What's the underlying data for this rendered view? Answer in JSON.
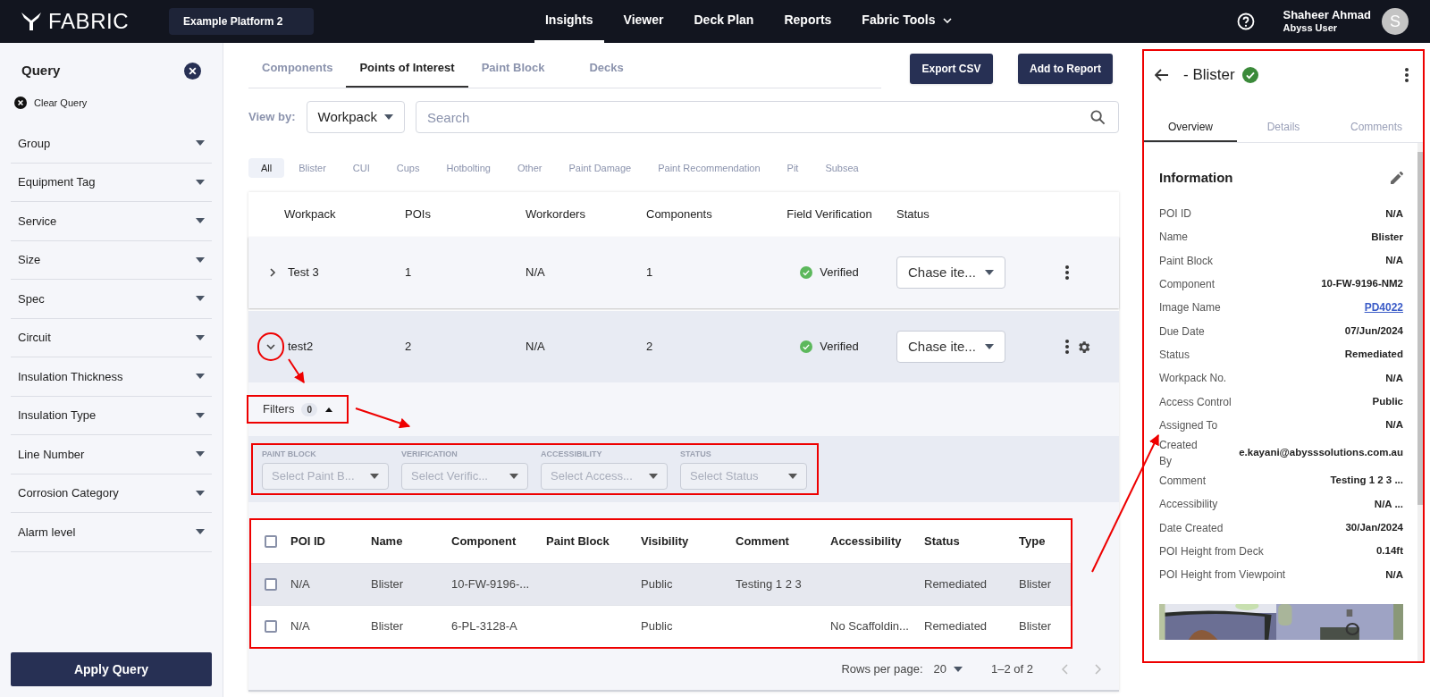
{
  "app": {
    "logo": "FABRIC",
    "platform": "Example Platform 2"
  },
  "nav": [
    {
      "label": "Insights",
      "selected": true,
      "has_menu": false
    },
    {
      "label": "Viewer",
      "selected": false,
      "has_menu": false
    },
    {
      "label": "Deck Plan",
      "selected": false,
      "has_menu": false
    },
    {
      "label": "Reports",
      "selected": false,
      "has_menu": false
    },
    {
      "label": "Fabric Tools",
      "selected": false,
      "has_menu": true
    }
  ],
  "user": {
    "name": "Shaheer Ahmad",
    "role": "Abyss User",
    "initial": "S"
  },
  "query": {
    "title": "Query",
    "clear": "Clear Query",
    "filters": [
      "Group",
      "Equipment Tag",
      "Service",
      "Size",
      "Spec",
      "Circuit",
      "Insulation Thickness",
      "Insulation Type",
      "Line Number",
      "Corrosion Category",
      "Alarm level"
    ],
    "apply": "Apply Query"
  },
  "tabs": [
    {
      "label": "Components",
      "selected": false
    },
    {
      "label": "Points of Interest",
      "selected": true
    },
    {
      "label": "Paint Block",
      "selected": false
    },
    {
      "label": "Decks",
      "selected": false
    }
  ],
  "actions": [
    "Export CSV",
    "Add to Report"
  ],
  "view_by": {
    "label": "View by:",
    "value": "Workpack"
  },
  "search": {
    "placeholder": "Search"
  },
  "chips": [
    {
      "label": "All",
      "selected": true
    },
    {
      "label": "Blister",
      "selected": false
    },
    {
      "label": "CUI",
      "selected": false
    },
    {
      "label": "Cups",
      "selected": false
    },
    {
      "label": "Hotbolting",
      "selected": false
    },
    {
      "label": "Other",
      "selected": false
    },
    {
      "label": "Paint Damage",
      "selected": false
    },
    {
      "label": "Paint Recommendation",
      "selected": false
    },
    {
      "label": "Pit",
      "selected": false
    },
    {
      "label": "Subsea",
      "selected": false
    }
  ],
  "workpacks": {
    "columns": [
      "Workpack",
      "POIs",
      "Workorders",
      "Components",
      "Field Verification",
      "Status"
    ],
    "rows": [
      {
        "name": "Test 3",
        "pois": "1",
        "workorders": "N/A",
        "components": "1",
        "verification": "Verified",
        "verified": true,
        "status": "Chase ite...",
        "expanded": false,
        "settings": false
      },
      {
        "name": "test2",
        "pois": "2",
        "workorders": "N/A",
        "components": "2",
        "verification": "Verified",
        "verified": true,
        "status": "Chase ite...",
        "expanded": true,
        "settings": true
      }
    ]
  },
  "filters": {
    "label": "Filters",
    "count": "0",
    "expanded": true,
    "fields": [
      {
        "label": "PAINT BLOCK",
        "placeholder": "Select Paint B..."
      },
      {
        "label": "VERIFICATION",
        "placeholder": "Select Verific..."
      },
      {
        "label": "ACCESSIBILITY",
        "placeholder": "Select Access..."
      },
      {
        "label": "STATUS",
        "placeholder": "Select Status"
      }
    ]
  },
  "poi_table": {
    "all_checked": false,
    "columns": [
      "POI ID",
      "Name",
      "Component",
      "Paint Block",
      "Visibility",
      "Comment",
      "Accessibility",
      "Status",
      "Type"
    ],
    "rows": [
      {
        "checked": false,
        "selected": true,
        "cells": [
          "N/A",
          "Blister",
          "10-FW-9196-...",
          "",
          "Public",
          "Testing 1 2 3",
          "",
          "Remediated",
          "Blister"
        ]
      },
      {
        "checked": false,
        "selected": false,
        "cells": [
          "N/A",
          "Blister",
          "6-PL-3128-A",
          "",
          "Public",
          "",
          "No Scaffoldin...",
          "Remediated",
          "Blister"
        ]
      }
    ]
  },
  "pagination": {
    "label": "Rows per page:",
    "rows": "20",
    "range": "1–2 of 2"
  },
  "detail": {
    "title": "- Blister",
    "verified": true,
    "tabs": [
      {
        "label": "Overview",
        "selected": true
      },
      {
        "label": "Details",
        "selected": false
      },
      {
        "label": "Comments",
        "selected": false
      }
    ],
    "section": "Information",
    "fields": [
      {
        "label": "POI ID",
        "value": "N/A",
        "kind": "text"
      },
      {
        "label": "Name",
        "value": "Blister",
        "kind": "text"
      },
      {
        "label": "Paint Block",
        "value": "N/A",
        "kind": "text"
      },
      {
        "label": "Component",
        "value": "10-FW-9196-NM2",
        "kind": "text"
      },
      {
        "label": "Image Name",
        "value": "PD4022",
        "kind": "link"
      },
      {
        "label": "Due Date",
        "value": "07/Jun/2024",
        "kind": "text"
      },
      {
        "label": "Status",
        "value": "Remediated",
        "kind": "text"
      },
      {
        "label": "Workpack No.",
        "value": "N/A",
        "kind": "text"
      },
      {
        "label": "Access Control",
        "value": "Public",
        "kind": "text"
      },
      {
        "label": "Assigned To",
        "value": "N/A",
        "kind": "text"
      },
      {
        "label": "Created By",
        "value": "e.kayani@abysssolutions.com.au",
        "kind": "text"
      },
      {
        "label": "Comment",
        "value": "Testing 1 2 3 ...",
        "kind": "text"
      },
      {
        "label": "Accessibility",
        "value": "N/A ...",
        "kind": "text"
      },
      {
        "label": "Date Created",
        "value": "30/Jan/2024",
        "kind": "text"
      },
      {
        "label": "POI Height from Deck",
        "value": "0.14ft",
        "kind": "text"
      },
      {
        "label": "POI Height from Viewpoint",
        "value": "N/A",
        "kind": "text"
      }
    ]
  }
}
